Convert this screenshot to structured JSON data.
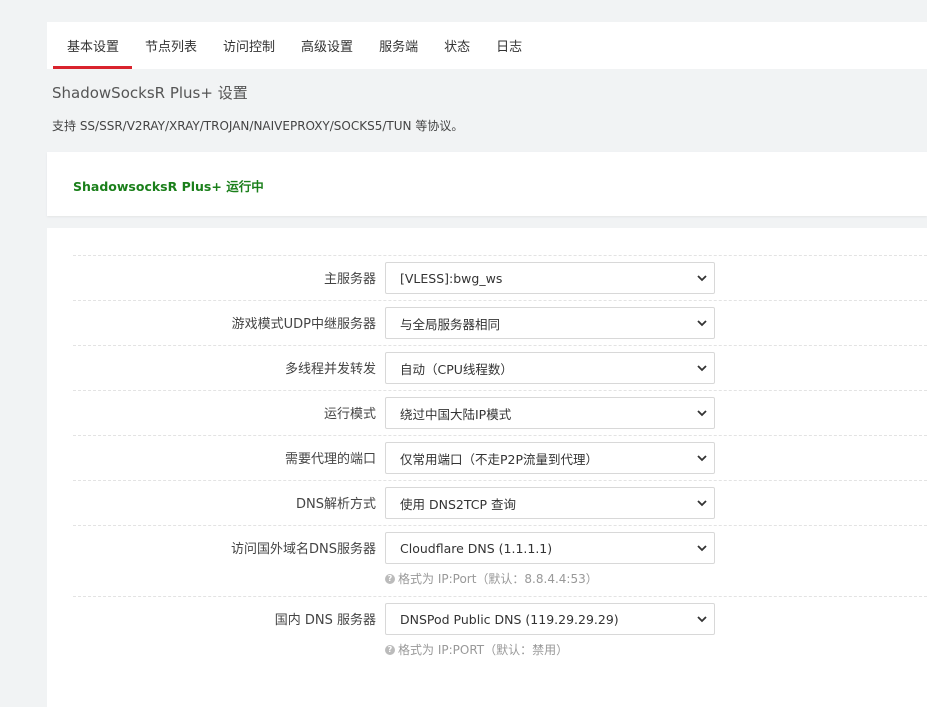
{
  "tabs": [
    {
      "label": "基本设置",
      "active": true
    },
    {
      "label": "节点列表"
    },
    {
      "label": "访问控制"
    },
    {
      "label": "高级设置"
    },
    {
      "label": "服务端"
    },
    {
      "label": "状态"
    },
    {
      "label": "日志"
    }
  ],
  "page": {
    "title": "ShadowSocksR Plus+ 设置",
    "description": "支持 SS/SSR/V2RAY/XRAY/TROJAN/NAIVEPROXY/SOCKS5/TUN 等协议。"
  },
  "status": {
    "text": "ShadowsocksR Plus+ 运行中",
    "color": "#1a7f1a"
  },
  "form": {
    "fields": [
      {
        "label": "主服务器",
        "value": "[VLESS]:bwg_ws"
      },
      {
        "label": "游戏模式UDP中继服务器",
        "value": "与全局服务器相同"
      },
      {
        "label": "多线程并发转发",
        "value": "自动（CPU线程数）"
      },
      {
        "label": "运行模式",
        "value": "绕过中国大陆IP模式"
      },
      {
        "label": "需要代理的端口",
        "value": "仅常用端口（不走P2P流量到代理）"
      },
      {
        "label": "DNS解析方式",
        "value": "使用 DNS2TCP 查询"
      },
      {
        "label": "访问国外域名DNS服务器",
        "value": "Cloudflare DNS (1.1.1.1)",
        "hint": "格式为 IP:Port（默认：8.8.4.4:53）"
      },
      {
        "label": "国内 DNS 服务器",
        "value": "DNSPod Public DNS (119.29.29.29)",
        "hint": "格式为 IP:PORT（默认：禁用）"
      }
    ]
  },
  "colors": {
    "accent": "#d9232d",
    "background": "#f1f3f4"
  }
}
